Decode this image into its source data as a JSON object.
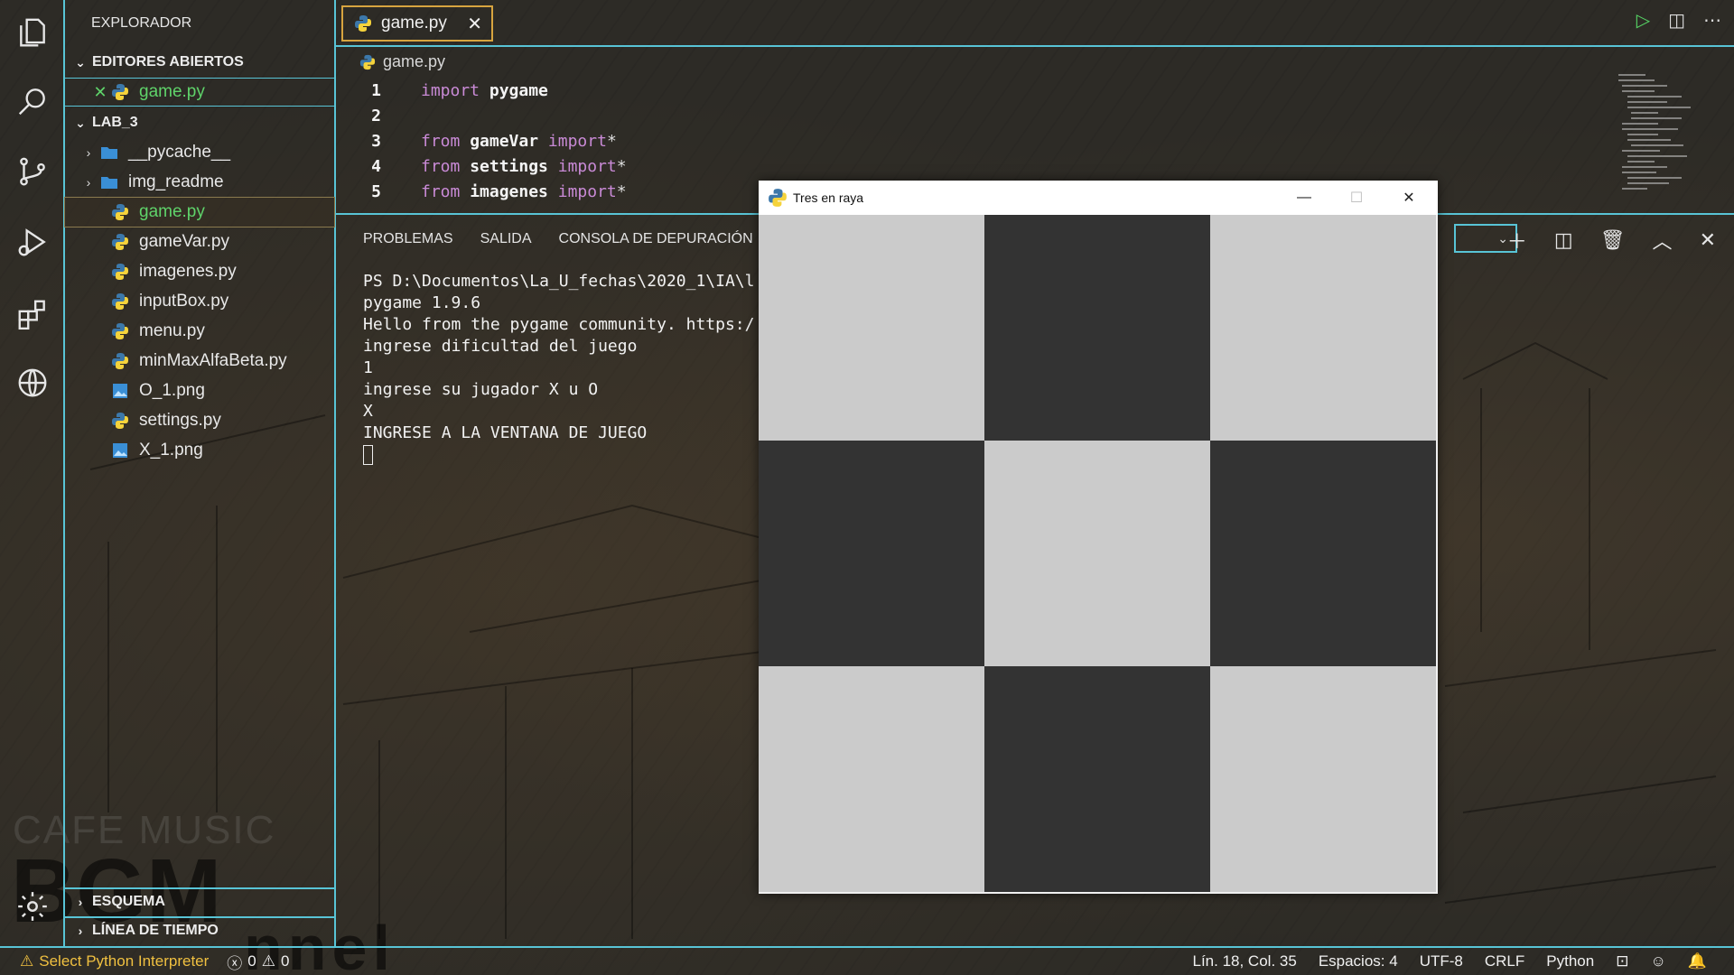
{
  "sidebar": {
    "title": "EXPLORADOR",
    "open_editors_header": "EDITORES ABIERTOS",
    "open_editor_file": "game.py",
    "folder_header": "LAB_3",
    "items": [
      {
        "label": "__pycache__",
        "type": "folder"
      },
      {
        "label": "img_readme",
        "type": "folder"
      },
      {
        "label": "game.py",
        "type": "python"
      },
      {
        "label": "gameVar.py",
        "type": "python"
      },
      {
        "label": "imagenes.py",
        "type": "python"
      },
      {
        "label": "inputBox.py",
        "type": "python"
      },
      {
        "label": "menu.py",
        "type": "python"
      },
      {
        "label": "minMaxAlfaBeta.py",
        "type": "python"
      },
      {
        "label": "O_1.png",
        "type": "image"
      },
      {
        "label": "settings.py",
        "type": "python"
      },
      {
        "label": "X_1.png",
        "type": "image"
      }
    ],
    "outline_header": "ESQUEMA",
    "timeline_header": "LÍNEA DE TIEMPO"
  },
  "editor": {
    "tab_label": "game.py",
    "breadcrumb": "game.py",
    "lines": [
      {
        "num": "1",
        "kw1": "import",
        "mod": "pygame",
        "kw2": "",
        "tail": ""
      },
      {
        "num": "2",
        "kw1": "",
        "mod": "",
        "kw2": "",
        "tail": ""
      },
      {
        "num": "3",
        "kw1": "from",
        "mod": "gameVar",
        "kw2": "import",
        "tail": "*"
      },
      {
        "num": "4",
        "kw1": "from",
        "mod": "settings",
        "kw2": "import",
        "tail": "*"
      },
      {
        "num": "5",
        "kw1": "from",
        "mod": "imagenes",
        "kw2": "import",
        "tail": "*"
      }
    ]
  },
  "panel": {
    "tabs": [
      "PROBLEMAS",
      "SALIDA",
      "CONSOLA DE DEPURACIÓN"
    ],
    "terminal_lines": [
      "PS D:\\Documentos\\La_U_fechas\\2020_1\\IA\\l",
      "pygame 1.9.6",
      "Hello from the pygame community. https:/",
      "ingrese dificultad del juego",
      "1",
      "ingrese su jugador X u O",
      "X",
      "INGRESE A LA VENTANA DE JUEGO"
    ]
  },
  "game_window": {
    "title": "Tres en raya",
    "board": [
      [
        "light",
        "dark",
        "light"
      ],
      [
        "dark",
        "light",
        "dark"
      ],
      [
        "light",
        "dark",
        "light"
      ]
    ]
  },
  "statusbar": {
    "interpreter": "Select Python Interpreter",
    "errors": "0",
    "warnings": "0",
    "position": "Lín. 18, Col. 35",
    "spaces": "Espacios: 4",
    "encoding": "UTF-8",
    "eol": "CRLF",
    "language": "Python"
  },
  "watermark": {
    "line1": "CAFE MUSIC",
    "line2": "BGM",
    "line3": "nnel"
  },
  "colors": {
    "accent": "#58c4d6",
    "modified": "#5fd36a",
    "keyword": "#c98ad6",
    "tab_border": "#d7a43f",
    "warning": "#f0c040",
    "board_light": "#cbcbcb",
    "board_dark": "#333333"
  }
}
